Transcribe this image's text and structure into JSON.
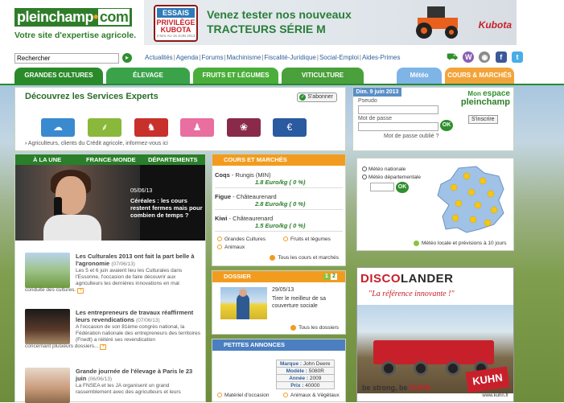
{
  "logo": {
    "brand_main": "pleinchamp",
    "brand_dot": "•",
    "brand_tld": "com",
    "tagline": "Votre site d'expertise agricole."
  },
  "banner": {
    "badge_top": "ESSAIS",
    "badge_mid1": "PRIVILÈGE",
    "badge_mid2": "KUBOTA",
    "badge_dates": "3 MAI AU 15 JUIN 2013",
    "line1": "Venez tester nos nouveaux",
    "line2": "TRACTEURS SÉRIE M",
    "brand": "Kubota"
  },
  "search": {
    "placeholder": "Rechercher",
    "value": "Rechercher"
  },
  "toplinks": [
    "Actualités",
    "Agenda",
    "Forums",
    "Machinisme",
    "Fiscalité-Juridique",
    "Social-Emploi",
    "Aides-Primes"
  ],
  "nav": {
    "tabs": [
      {
        "label": "GRANDES CULTURES",
        "color": "#2a8a2a"
      },
      {
        "label": "ÉLEVAGE",
        "color": "#3aa34a"
      },
      {
        "label": "FRUITS ET LÉGUMES",
        "color": "#4aae3a"
      },
      {
        "label": "VITICULTURE",
        "color": "#4aa03a"
      },
      {
        "label": "Météo",
        "color": "#7fb4e6"
      },
      {
        "label": "COURS & MARCHÉS",
        "color": "#f2a43a"
      }
    ]
  },
  "experts": {
    "title": "Découvrez les Services Experts",
    "subscribe": "S'abonner",
    "services": [
      {
        "icon": "weather-icon",
        "glyph": "☁",
        "color": "#3a8ad0"
      },
      {
        "icon": "wheat-icon",
        "glyph": "❦",
        "color": "#8ab83a"
      },
      {
        "icon": "cow-icon",
        "glyph": "♞",
        "color": "#c8302b"
      },
      {
        "icon": "pig-icon",
        "glyph": "♟",
        "color": "#e86fa0"
      },
      {
        "icon": "grape-icon",
        "glyph": "❀",
        "color": "#8a2a4a"
      },
      {
        "icon": "euro-icon",
        "glyph": "€",
        "color": "#2a5aa0"
      }
    ],
    "note": "Agriculteurs, clients du Crédit agricole, informez-vous ici"
  },
  "account": {
    "date": "Dim. 9 juin 2013",
    "mon": "Mon",
    "espace": "espace",
    "brand": "pleinchamp",
    "pseudo_label": "Pseudo",
    "password_label": "Mot de passe",
    "ok": "OK",
    "register": "S'inscrire",
    "forgot": "Mot de passe oublié ?"
  },
  "news": {
    "tabs": [
      "À LA UNE",
      "FRANCE-MONDE",
      "DÉPARTEMENTS"
    ],
    "hero": {
      "date": "05/06/13",
      "headline": "Céréales : les cours restent fermes mais pour combien de temps ?"
    },
    "items": [
      {
        "title": "Les Culturales 2013 ont fait la part belle à l'agronomie",
        "date": "(07/06/13)",
        "text": "Les 5 et 6 juin avaient lieu les Culturales dans l'Essonne, l'occasion de faire découvrir aux agriculteurs les dernières innovations en mat",
        "text2": "conduite des cultures.",
        "thumb": "#7fa860"
      },
      {
        "title": "Les entrepreneurs de travaux réaffirment leurs revendications",
        "date": "(07/06/13)",
        "text": "A l'occasion de son 81ème congrès national, la Fédération nationale des entrepreneurs des territoires (Fnedt) a réitéré ses revendication",
        "text2": "concernant plusieurs dossiers...",
        "thumb": "#5a3a2a"
      },
      {
        "title": "Grande journée de l'élevage à Paris le 23 juin",
        "date": "(06/06/13)",
        "text": "La FNSEA et les JA organisent un grand rassemblement avec des agriculteurs et leurs",
        "text2": "",
        "thumb": "#c89a7a"
      }
    ]
  },
  "cours": {
    "header": "COURS ET MARCHÉS",
    "quotes": [
      {
        "name": "Coqs",
        "place": " - Rungis (MIN)",
        "value": "1.8 Euro/kg ( 0 %)"
      },
      {
        "name": "Figue",
        "place": " - Châteaurenard",
        "value": "2.8 Euro/kg ( 0 %)"
      },
      {
        "name": "Kiwi",
        "place": " - Châteaurenard",
        "value": "1.5 Euro/kg ( 0 %)"
      }
    ],
    "cats": [
      "Grandes Cultures",
      "Fruits et légumes",
      "Animaux"
    ],
    "more": "Tous les cours et marchés"
  },
  "dossier": {
    "header": "DOSSIER",
    "pages": [
      "1",
      "2"
    ],
    "date": "29/05/13",
    "text": "Tirer le meilleur de sa couverture sociale",
    "more": "Tous les dossiers"
  },
  "annonces": {
    "header": "PETITES ANNONCES",
    "rows": [
      {
        "k": "Marque : ",
        "v": "John Deere"
      },
      {
        "k": "Modèle : ",
        "v": "5080R"
      },
      {
        "k": "Année : ",
        "v": "2009"
      },
      {
        "k": "Prix : ",
        "v": "40000"
      }
    ],
    "cats": [
      "Matériel d'occasion",
      "Animaux & Végétaux"
    ]
  },
  "meteo": {
    "nationale": "Météo nationale",
    "departementale": "Météo départementale",
    "ok": "OK",
    "foot": "Météo locale et prévisions à 10 jours"
  },
  "ad": {
    "logo_a": "DISCO",
    "logo_b": "LANDER",
    "ref": "\"La référence innovante !\"",
    "strong_a": "be strong, be ",
    "strong_b": "KUHN",
    "kuhn": "KUHN",
    "url": "www.kuhn.fr"
  },
  "colors": {
    "brand_green": "#2f7d2a",
    "orange": "#f29c1f",
    "blue": "#4b7fc0"
  }
}
